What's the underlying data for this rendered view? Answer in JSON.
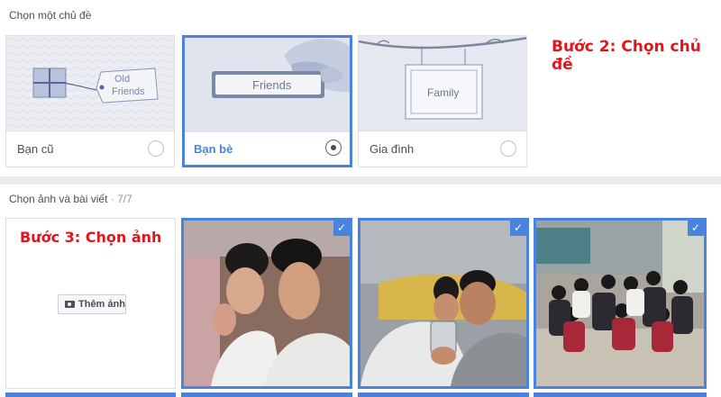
{
  "theme_section": {
    "label": "Chọn một chủ đề",
    "themes": [
      {
        "name": "Bạn cũ",
        "tag_line1": "Old",
        "tag_line2": "Friends",
        "selected": false
      },
      {
        "name": "Bạn bè",
        "tag": "Friends",
        "selected": true
      },
      {
        "name": "Gia đình",
        "tag": "Family",
        "selected": false
      }
    ]
  },
  "annotations": {
    "step2": "Bước 2: Chọn chủ đề",
    "step3": "Bước 3: Chọn ảnh"
  },
  "photo_section": {
    "label": "Chọn ảnh và bài viết",
    "separator": " · ",
    "count": "7/7",
    "add_photo_label": "Thêm ảnh",
    "check_glyph": "✓"
  },
  "colors": {
    "accent": "#4a83de",
    "annotation": "#e0161c"
  }
}
